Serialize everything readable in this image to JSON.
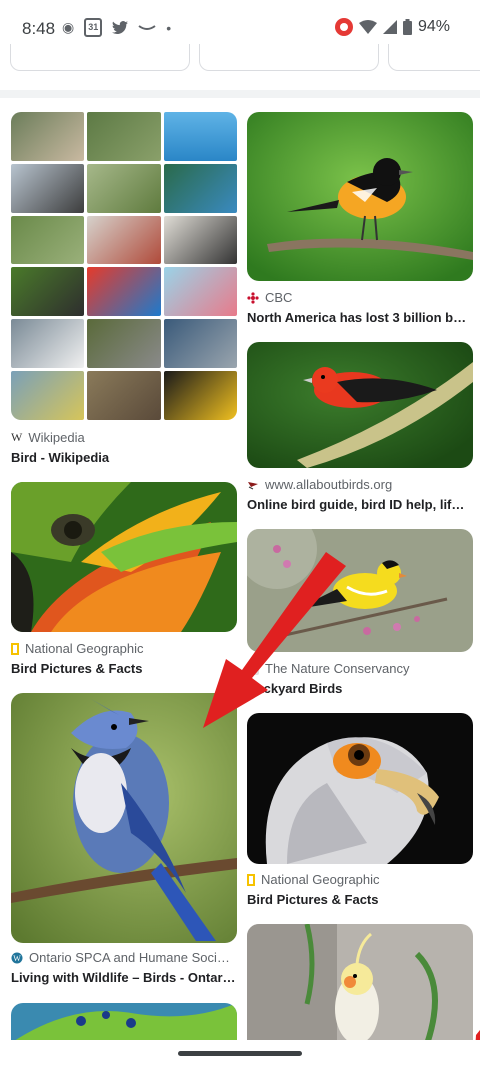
{
  "status_bar": {
    "time": "8:48",
    "calendar_date": "31",
    "battery": "94%"
  },
  "colors": {
    "annotation_arrow": "#e02020",
    "background": "#ffffff"
  },
  "results": [
    {
      "source": "Wikipedia",
      "title": "Bird - Wikipedia",
      "source_icon": "wikipedia-icon"
    },
    {
      "source": "CBC",
      "title": "North America has lost 3 billion bir…",
      "source_icon": "cbc-icon"
    },
    {
      "source": "www.allaboutbirds.org",
      "title": "Online bird guide, bird ID help, life …",
      "source_icon": "allaboutbirds-icon"
    },
    {
      "source": "National Geographic",
      "title": "Bird Pictures & Facts",
      "source_icon": "natgeo-icon"
    },
    {
      "source": "The Nature Conservancy",
      "title": "Backyard Birds",
      "source_icon": "nature-conservancy-icon"
    },
    {
      "source": "Ontario SPCA and Humane Soci…",
      "title": "Living with Wildlife – Birds - Ontari…",
      "source_icon": "wordpress-icon"
    },
    {
      "source": "National Geographic",
      "title": "Bird Pictures & Facts",
      "source_icon": "natgeo-icon"
    }
  ]
}
